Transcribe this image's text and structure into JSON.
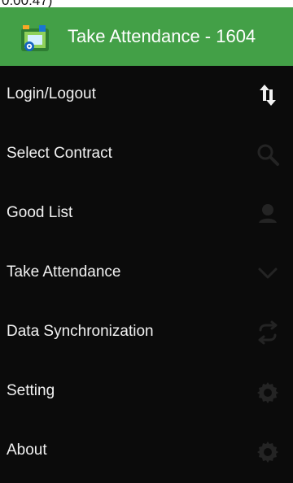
{
  "status_bar": {
    "partial_text": "0:00:47)"
  },
  "app_bar": {
    "title": "Take Attendance - 1604",
    "logo_icon": "app-logo-icon",
    "accent": "#43a047"
  },
  "drawer": {
    "background": "#0b0b0b",
    "items": [
      {
        "label": "Login/Logout",
        "icon": "login-logout-arrows-icon"
      },
      {
        "label": "Select Contract",
        "icon": "search-icon"
      },
      {
        "label": "Good List",
        "icon": "person-icon"
      },
      {
        "label": "Take Attendance",
        "icon": "chevron-down-icon"
      },
      {
        "label": "Data Synchronization",
        "icon": "sync-icon"
      },
      {
        "label": "Setting",
        "icon": "gear-icon"
      },
      {
        "label": "About",
        "icon": "gear-icon"
      }
    ]
  }
}
